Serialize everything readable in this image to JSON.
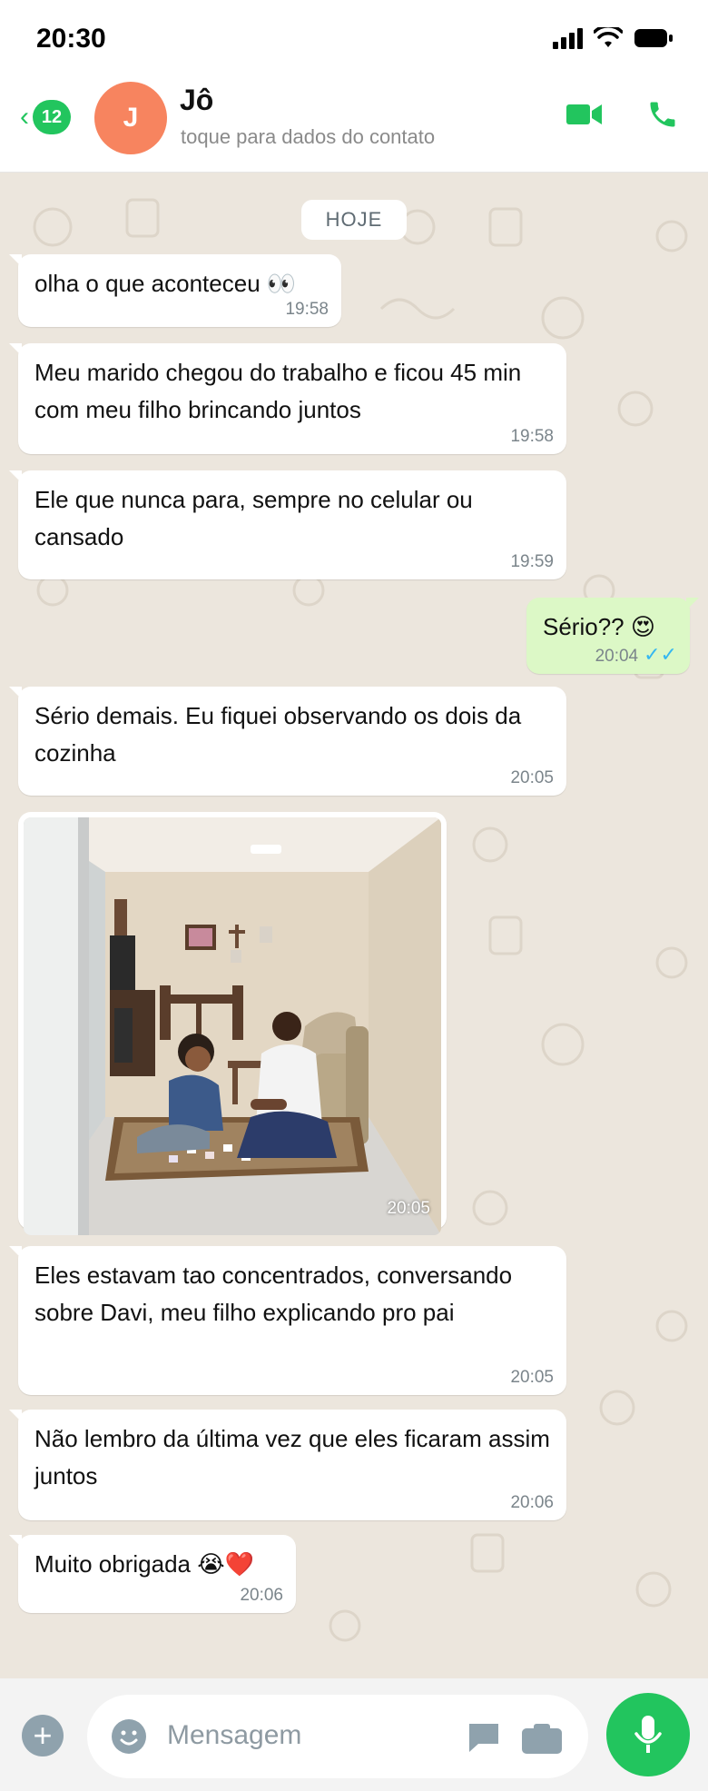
{
  "status": {
    "time": "20:30"
  },
  "header": {
    "back_count": "12",
    "avatar_initial": "J",
    "contact_name": "Jô",
    "contact_subtitle": "toque para dados do contato"
  },
  "chat": {
    "date_divider": "HOJE",
    "messages": [
      {
        "direction": "in",
        "text": "olha o que aconteceu 👀",
        "time": "19:58"
      },
      {
        "direction": "in",
        "text": "Meu marido chegou do trabalho e ficou 45 min com meu filho brincando juntos",
        "time": "19:58"
      },
      {
        "direction": "in",
        "text": "Ele que nunca para, sempre no celular ou cansado",
        "time": "19:59"
      },
      {
        "direction": "out",
        "text": "Sério?? 😍",
        "time": "20:04",
        "status": "✓✓"
      },
      {
        "direction": "in",
        "text": "Sério demais. Eu fiquei observando os dois da cozinha",
        "time": "20:05"
      },
      {
        "direction": "in",
        "type": "image",
        "time": "20:05"
      },
      {
        "direction": "in",
        "text": "Eles estavam tao concentrados, conversando sobre Davi, meu filho explicando pro pai",
        "time": "20:05"
      },
      {
        "direction": "in",
        "text": "Não lembro da última vez que eles ficaram assim juntos",
        "time": "20:06"
      },
      {
        "direction": "in",
        "text": "Muito obrigada 😭❤️",
        "time": "20:06"
      }
    ]
  },
  "input": {
    "placeholder": "Mensagem"
  },
  "colors": {
    "accent": "#22c55e",
    "avatar": "#f7845f",
    "chat_bg": "#ece6dd",
    "outgoing": "#dcf8c6",
    "ticks": "#34b7f1"
  },
  "icons": [
    "signal-icon",
    "wifi-icon",
    "battery-icon",
    "back-chevron-icon",
    "video-call-icon",
    "phone-icon",
    "plus-icon",
    "emoji-icon",
    "sticker-icon",
    "camera-icon",
    "mic-icon"
  ]
}
